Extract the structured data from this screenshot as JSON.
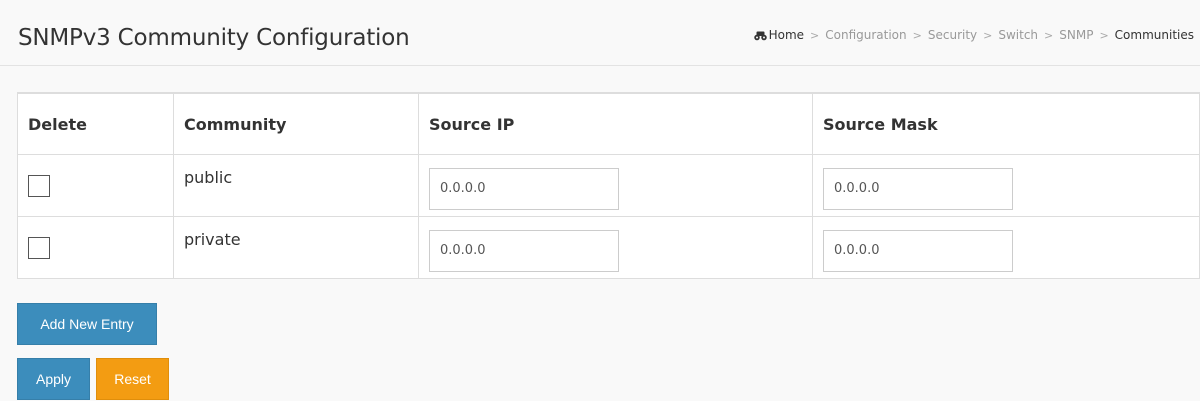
{
  "header": {
    "title": "SNMPv3 Community Configuration",
    "breadcrumb": {
      "home": "Home",
      "items": [
        "Configuration",
        "Security",
        "Switch",
        "SNMP"
      ],
      "current": "Communities",
      "separator": ">"
    }
  },
  "table": {
    "columns": [
      "Delete",
      "Community",
      "Source IP",
      "Source Mask"
    ],
    "rows": [
      {
        "delete": false,
        "community": "public",
        "source_ip": "0.0.0.0",
        "source_mask": "0.0.0.0"
      },
      {
        "delete": false,
        "community": "private",
        "source_ip": "0.0.0.0",
        "source_mask": "0.0.0.0"
      }
    ]
  },
  "buttons": {
    "add_new_entry": "Add New Entry",
    "apply": "Apply",
    "reset": "Reset"
  },
  "colors": {
    "primary_button": "#3c8dbc",
    "warning_button": "#f39c12",
    "background": "#f9f9f9"
  },
  "icons": {
    "home": "home-icon"
  }
}
